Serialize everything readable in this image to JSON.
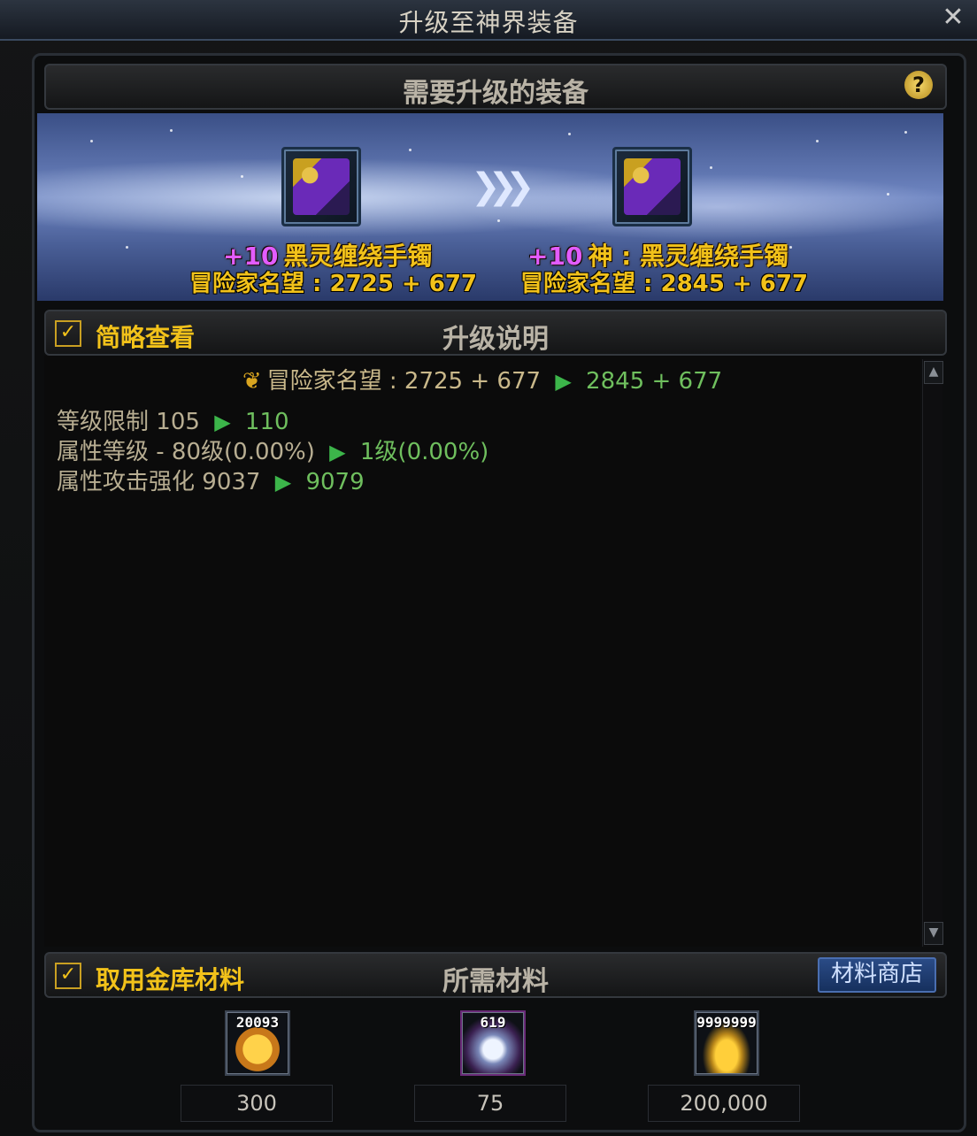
{
  "window": {
    "title": "升级至神界装备",
    "close_glyph": "✕"
  },
  "equipment_section": {
    "title": "需要升级的装备",
    "help_glyph": "?",
    "source_item": {
      "enhance": "+10",
      "name": "黑灵缠绕手镯",
      "reputation": "冒险家名望 : 2725 + 677"
    },
    "target_item": {
      "enhance": "+10",
      "name": "神 : 黑灵缠绕手镯",
      "reputation": "冒险家名望 : 2845 + 677"
    },
    "arrow_glyph": "❯❯❯"
  },
  "upgrade_section": {
    "brief_view_label": "简略查看",
    "brief_view_checked": true,
    "title": "升级说明",
    "reputation_label": "冒险家名望",
    "reputation_from": ": 2725 + 677",
    "reputation_to": "2845 + 677",
    "stats": [
      {
        "label": "等级限制",
        "from": "105",
        "to": "110"
      },
      {
        "label": "属性等级 -",
        "from": "80级(0.00%)",
        "to": "1级(0.00%)"
      },
      {
        "label": "属性攻击强化",
        "from": "9037",
        "to": "9079"
      }
    ]
  },
  "materials_section": {
    "vault_label": "取用金库材料",
    "vault_checked": true,
    "title": "所需材料",
    "shop_button": "材料商店",
    "items": [
      {
        "icon": "amber-gem-icon",
        "owned": "20093",
        "required": "300"
      },
      {
        "icon": "spirit-orb-icon",
        "owned": "619",
        "required": "75"
      },
      {
        "icon": "gold-coins-icon",
        "owned": "9999999",
        "required": "200,000"
      }
    ]
  }
}
